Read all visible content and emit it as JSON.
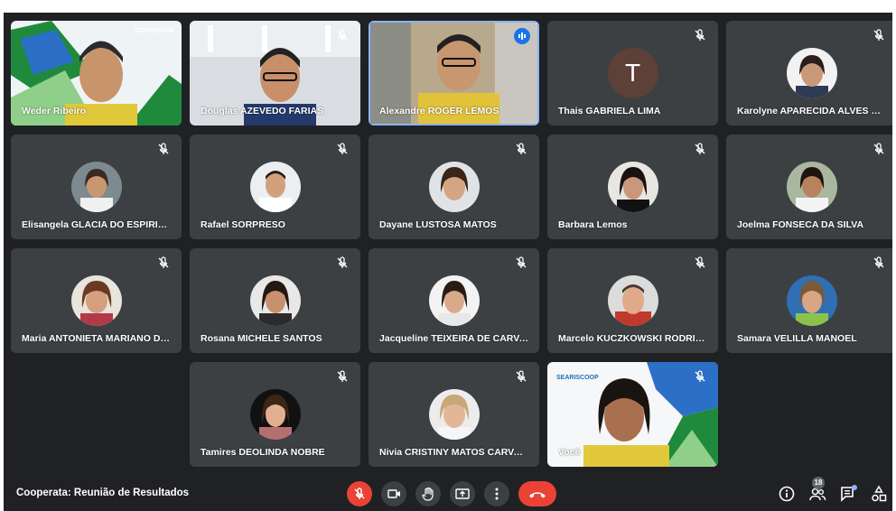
{
  "meeting": {
    "title": "Cooperata: Reunião de Resultados"
  },
  "participants_count": "18",
  "tiles": [
    {
      "name": "Weder Ribeiro",
      "brand": "COOPERATA"
    },
    {
      "name": "Douglas AZEVEDO FARIAS"
    },
    {
      "name": "Alexandre ROGER LEMOS"
    },
    {
      "name": "Thais GABRIELA LIMA",
      "initial": "T"
    },
    {
      "name": "Karolyne APARECIDA ALVES DE ..."
    },
    {
      "name": "Elisangela GLACIA DO ESPIRITO..."
    },
    {
      "name": "Rafael SORPRESO"
    },
    {
      "name": "Dayane LUSTOSA MATOS"
    },
    {
      "name": "Barbara Lemos"
    },
    {
      "name": "Joelma FONSECA DA SILVA"
    },
    {
      "name": "Maria ANTONIETA MARIANO DA..."
    },
    {
      "name": "Rosana MICHELE SANTOS"
    },
    {
      "name": "Jacqueline TEIXEIRA DE CARVA..."
    },
    {
      "name": "Marcelo KUCZKOWSKI RODRIG..."
    },
    {
      "name": "Samara VELILLA MANOEL"
    },
    {
      "name": "Tamires DEOLINDA NOBRE"
    },
    {
      "name": "Nivia CRISTINY MATOS CARVAL..."
    },
    {
      "name": "Você",
      "brand": "SEARISCOOP"
    }
  ],
  "colors": {
    "background": "#202124",
    "tile": "#3c4043",
    "speaking_border": "#8ab4f8",
    "hangup": "#ea4335",
    "mic_off": "#ea4335"
  },
  "icons": {
    "mic": "mic-off-icon",
    "camera": "camera-icon",
    "hand": "raise-hand-icon",
    "present": "present-screen-icon",
    "more": "more-options-icon",
    "hangup": "hang-up-icon",
    "info": "info-icon",
    "people": "people-icon",
    "chat": "chat-icon",
    "activities": "activities-icon"
  }
}
